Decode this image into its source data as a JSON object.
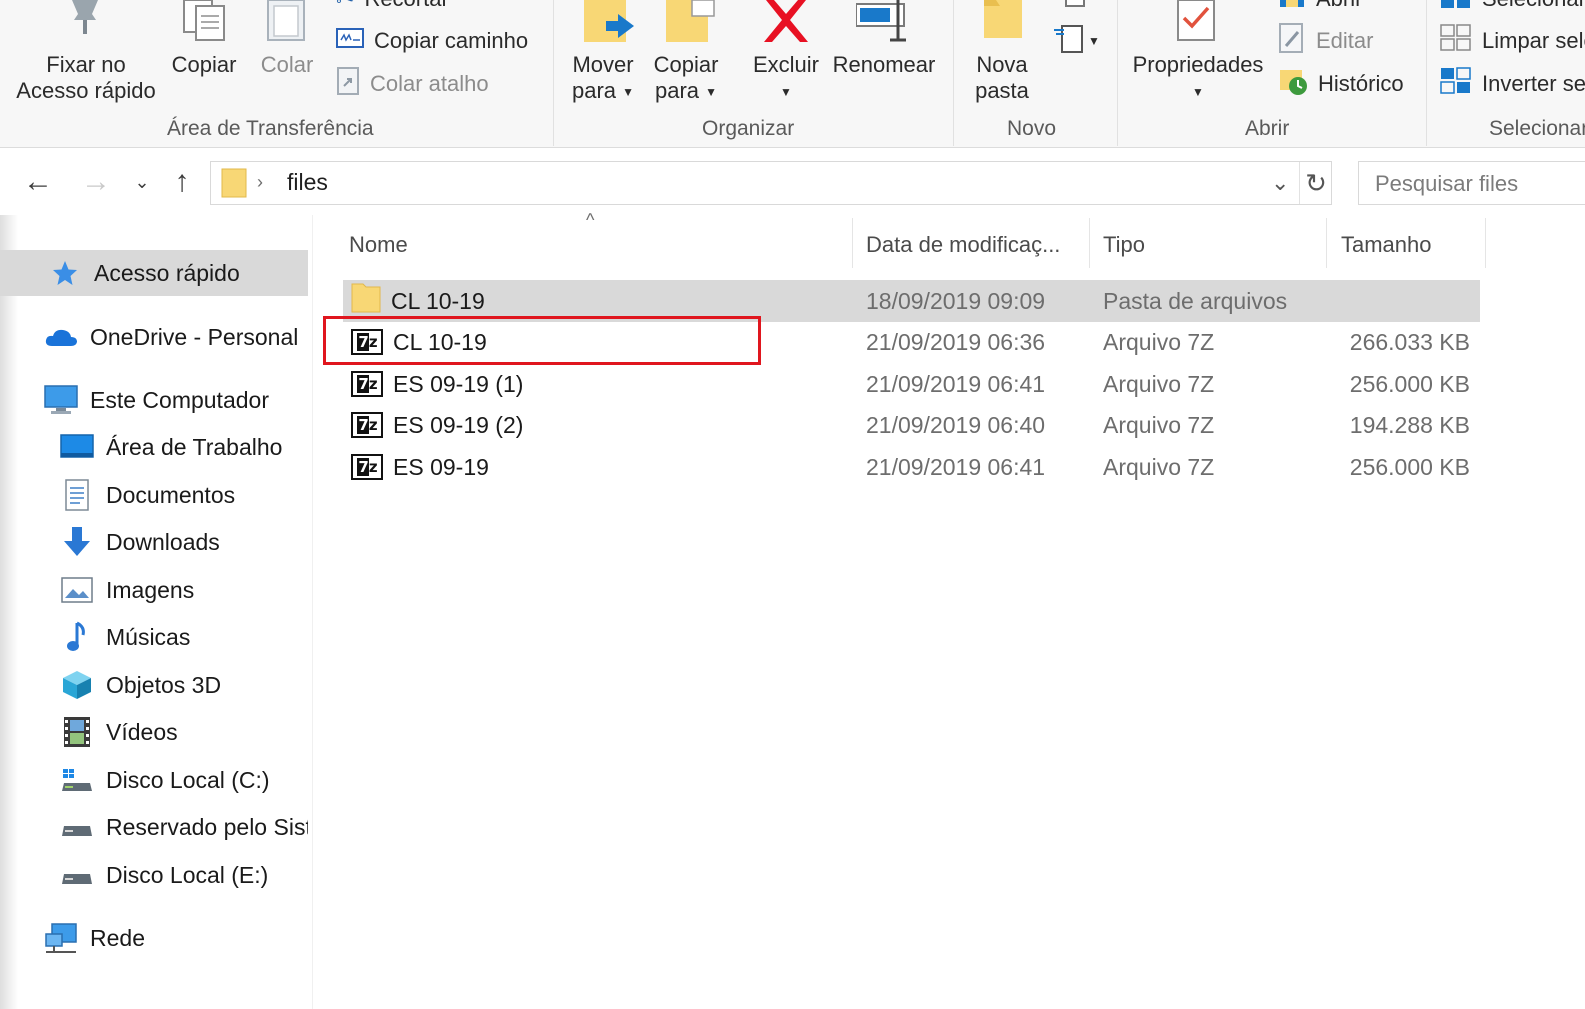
{
  "ribbon": {
    "clipboard": {
      "group_label": "Área de Transferência",
      "pin_label_1": "Fixar no",
      "pin_label_2": "Acesso rápido",
      "copy_label": "Copiar",
      "paste_label": "Colar",
      "cut_label": "Recortar",
      "copy_path_label": "Copiar caminho",
      "paste_shortcut_label": "Colar atalho"
    },
    "organize": {
      "group_label": "Organizar",
      "move_label_1": "Mover",
      "move_label_2": "para",
      "copyto_label_1": "Copiar",
      "copyto_label_2": "para",
      "delete_label": "Excluir",
      "rename_label": "Renomear"
    },
    "new": {
      "group_label": "Novo",
      "new_folder_label_1": "Nova",
      "new_folder_label_2": "pasta"
    },
    "open": {
      "group_label": "Abrir",
      "properties_label": "Propriedades",
      "open_label": "Abrir",
      "edit_label": "Editar",
      "history_label": "Histórico"
    },
    "select": {
      "group_label": "Selecionar",
      "select_all_label": "Selecionar",
      "select_none_label": "Limpar seleção",
      "invert_label": "Inverter seleção"
    }
  },
  "addressbar": {
    "path": "files",
    "search_placeholder": "Pesquisar files"
  },
  "sidebar": {
    "items": [
      {
        "label": "Acesso rápido",
        "icon": "star-icon",
        "selected": true
      },
      {
        "label": "OneDrive - Personal",
        "icon": "cloud-icon"
      },
      {
        "label": "Este Computador",
        "icon": "computer-icon"
      },
      {
        "label": "Área de Trabalho",
        "icon": "desktop-icon"
      },
      {
        "label": "Documentos",
        "icon": "documents-icon"
      },
      {
        "label": "Downloads",
        "icon": "downloads-icon"
      },
      {
        "label": "Imagens",
        "icon": "pictures-icon"
      },
      {
        "label": "Músicas",
        "icon": "music-icon"
      },
      {
        "label": "Objetos 3D",
        "icon": "objects3d-icon"
      },
      {
        "label": "Vídeos",
        "icon": "videos-icon"
      },
      {
        "label": "Disco Local (C:)",
        "icon": "drive-c-icon"
      },
      {
        "label": "Reservado pelo Sistema",
        "icon": "drive-icon"
      },
      {
        "label": "Disco Local (E:)",
        "icon": "drive-icon"
      },
      {
        "label": "Rede",
        "icon": "network-icon"
      }
    ]
  },
  "filelist": {
    "columns": {
      "name": "Nome",
      "date": "Data de modificaç...",
      "type": "Tipo",
      "size": "Tamanho"
    },
    "rows": [
      {
        "name": "CL 10-19",
        "date": "18/09/2019 09:09",
        "type": "Pasta de arquivos",
        "size": "",
        "icon": "folder-icon"
      },
      {
        "name": "CL 10-19",
        "date": "21/09/2019 06:36",
        "type": "Arquivo 7Z",
        "size": "266.033 KB",
        "icon": "7z-archive-icon"
      },
      {
        "name": "ES 09-19 (1)",
        "date": "21/09/2019 06:41",
        "type": "Arquivo 7Z",
        "size": "256.000 KB",
        "icon": "7z-archive-icon"
      },
      {
        "name": "ES 09-19 (2)",
        "date": "21/09/2019 06:40",
        "type": "Arquivo 7Z",
        "size": "194.288 KB",
        "icon": "7z-archive-icon"
      },
      {
        "name": "ES 09-19",
        "date": "21/09/2019 06:41",
        "type": "Arquivo 7Z",
        "size": "256.000 KB",
        "icon": "7z-archive-icon"
      }
    ]
  },
  "colors": {
    "highlight_border": "#e0161e",
    "selected_bg": "#d9d9d9",
    "folder_yellow": "#f8d775",
    "delete_red": "#e81123",
    "accent_blue": "#1979ca"
  }
}
